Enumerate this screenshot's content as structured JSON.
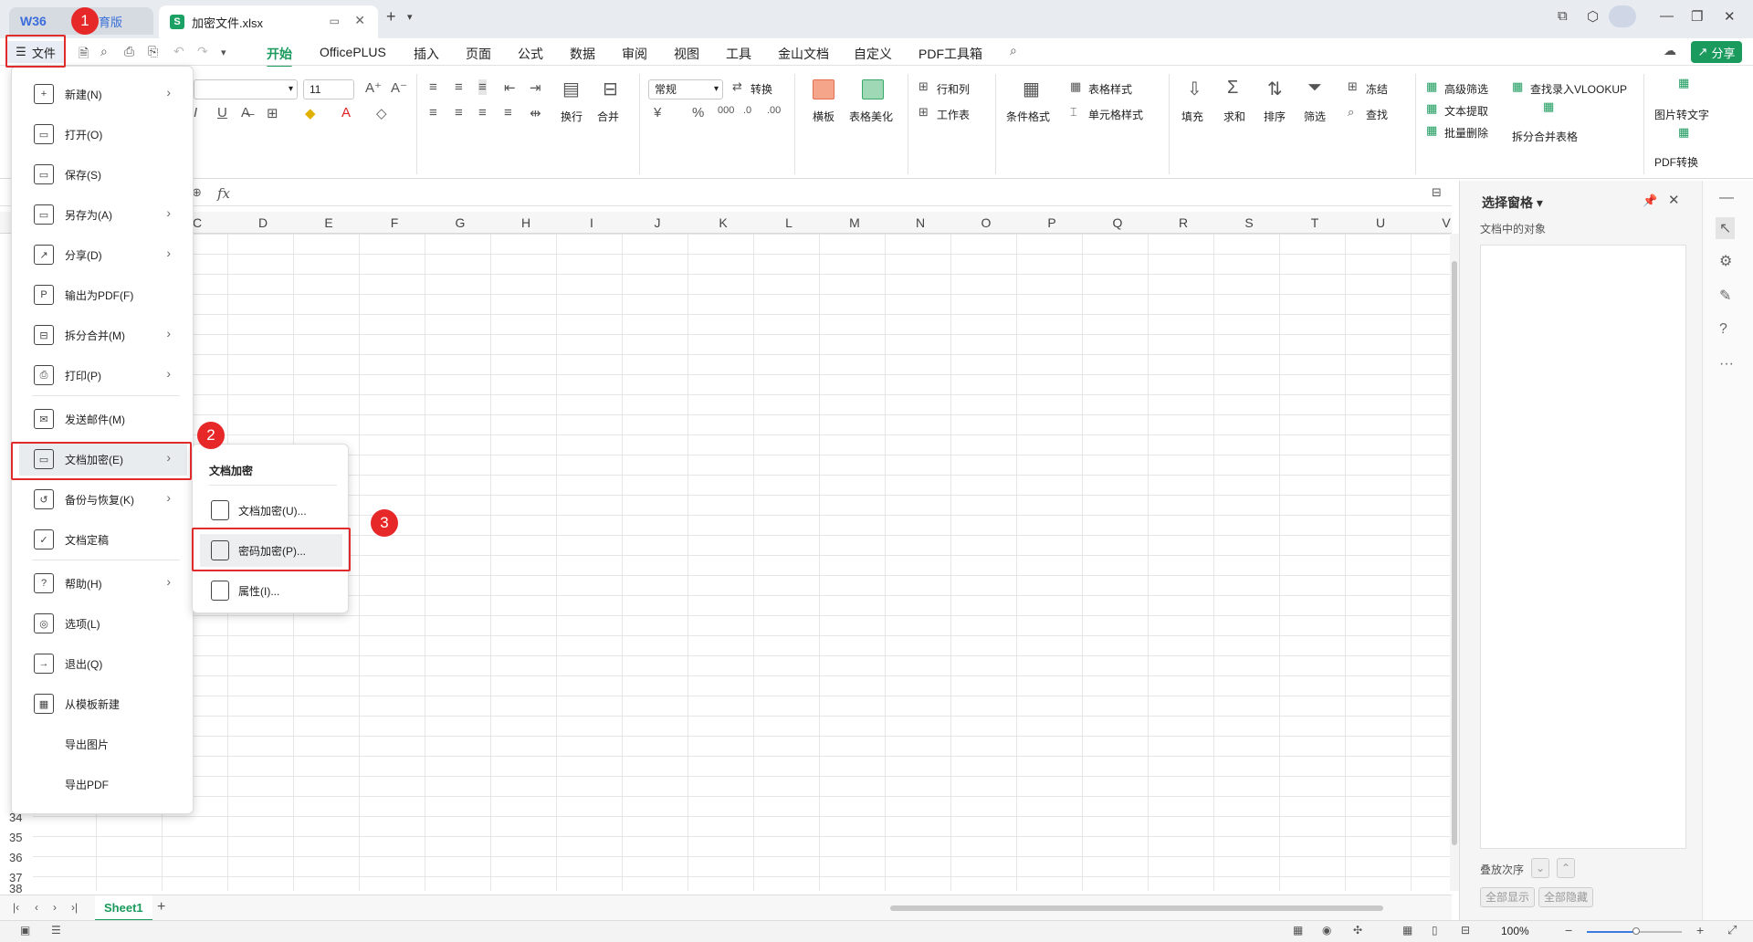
{
  "titlebar": {
    "tab1_logo": "W36",
    "tab1_label": "育版",
    "tab2_label": "加密文件.xlsx",
    "tab2_icon": "S"
  },
  "tabs": {
    "file": "文件",
    "items": [
      "开始",
      "OfficePLUS",
      "插入",
      "页面",
      "公式",
      "数据",
      "审阅",
      "视图",
      "工具",
      "金山文档",
      "自定义",
      "PDF工具箱"
    ],
    "share": "分享"
  },
  "ribbon": {
    "font_size": "11",
    "number_format": "常规",
    "convert": "转换",
    "wrap": "换行",
    "merge": "合并",
    "template": "横板",
    "beautify": "表格美化",
    "row_col": "行和列",
    "worksheet": "工作表",
    "cond_format": "条件格式",
    "table_style": "表格样式",
    "cell_style": "单元格样式",
    "fill": "填充",
    "sum": "求和",
    "sort": "排序",
    "filter": "筛选",
    "freeze": "冻结",
    "find": "查找",
    "adv_filter": "高级筛选",
    "text_extract": "文本提取",
    "batch_delete": "批量删除",
    "vlookup": "查找录入VLOOKUP",
    "split_merge": "拆分合并表格",
    "pic_to_text": "图片转文字",
    "pdf_convert": "PDF转换"
  },
  "formula": {
    "fx": "fx"
  },
  "columns": [
    "C",
    "D",
    "E",
    "F",
    "G",
    "H",
    "I",
    "J",
    "K",
    "L",
    "M",
    "N",
    "O",
    "P",
    "Q",
    "R",
    "S",
    "T",
    "U",
    "V"
  ],
  "rows": [
    "34",
    "35",
    "36",
    "37",
    "38"
  ],
  "sheet_tab": "Sheet1",
  "status": {
    "zoom": "100%"
  },
  "right_pane": {
    "title": "选择窗格",
    "subtitle": "文档中的对象",
    "order": "叠放次序",
    "show_all": "全部显示",
    "hide_all": "全部隐藏"
  },
  "file_menu": {
    "items": [
      {
        "label": "新建(N)",
        "arrow": true
      },
      {
        "label": "打开(O)",
        "arrow": false
      },
      {
        "label": "保存(S)",
        "arrow": false
      },
      {
        "label": "另存为(A)",
        "arrow": true
      },
      {
        "label": "分享(D)",
        "arrow": true
      },
      {
        "label": "输出为PDF(F)",
        "arrow": false
      },
      {
        "label": "拆分合并(M)",
        "arrow": true
      },
      {
        "label": "打印(P)",
        "arrow": true
      },
      {
        "label": "发送邮件(M)",
        "arrow": false
      },
      {
        "label": "文档加密(E)",
        "arrow": true
      },
      {
        "label": "备份与恢复(K)",
        "arrow": true
      },
      {
        "label": "文档定稿",
        "arrow": false
      },
      {
        "label": "帮助(H)",
        "arrow": true
      },
      {
        "label": "选项(L)",
        "arrow": false
      },
      {
        "label": "退出(Q)",
        "arrow": false
      },
      {
        "label": "从模板新建",
        "arrow": false
      },
      {
        "label": "导出图片",
        "arrow": false
      },
      {
        "label": "导出PDF",
        "arrow": false
      }
    ]
  },
  "submenu": {
    "header": "文档加密",
    "items": [
      "文档加密(U)...",
      "密码加密(P)...",
      "属性(I)..."
    ]
  },
  "annotations": [
    "1",
    "2",
    "3"
  ],
  "colors": {
    "accent": "#1a9a5c",
    "annotation": "#e12a2a"
  }
}
